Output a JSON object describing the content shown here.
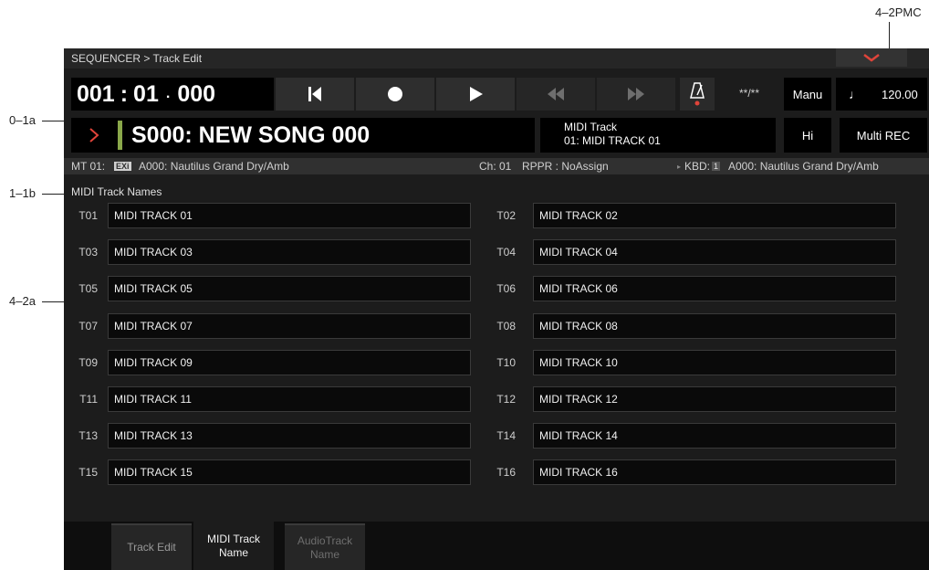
{
  "callouts": {
    "top_right": "4–2PMC",
    "left_1": "0–1a",
    "left_2": "1–1b",
    "left_3": "4–2a"
  },
  "titlebar": {
    "breadcrumb": "SEQUENCER > Track Edit"
  },
  "location": {
    "measure": "001",
    "sep1": ":",
    "beat": "01",
    "sep2": ".",
    "tick": "000"
  },
  "transport": {
    "meter": "**/**",
    "tempo_mode": "Manu",
    "tempo_icon": "♩",
    "tempo": "120.00"
  },
  "song": {
    "name": "S000: NEW SONG 000",
    "track_header": "MIDI Track",
    "track_name": "01: MIDI TRACK 01",
    "hi_label": "Hi",
    "rec_mode": "Multi REC"
  },
  "infobar": {
    "track": "MT 01:",
    "exi": "EXi",
    "program": "A000: Nautilus Grand Dry/Amb",
    "channel": "Ch: 01",
    "rppr": "RPPR : NoAssign",
    "kbd": "KBD:",
    "kbd_num": "1",
    "kbd_program": "A000: Nautilus Grand Dry/Amb"
  },
  "section": {
    "title": "MIDI Track Names"
  },
  "tracks": [
    {
      "id": "T01",
      "name": "MIDI TRACK 01"
    },
    {
      "id": "T02",
      "name": "MIDI TRACK 02"
    },
    {
      "id": "T03",
      "name": "MIDI TRACK 03"
    },
    {
      "id": "T04",
      "name": "MIDI TRACK 04"
    },
    {
      "id": "T05",
      "name": "MIDI TRACK 05"
    },
    {
      "id": "T06",
      "name": "MIDI TRACK 06"
    },
    {
      "id": "T07",
      "name": "MIDI TRACK 07"
    },
    {
      "id": "T08",
      "name": "MIDI TRACK 08"
    },
    {
      "id": "T09",
      "name": "MIDI TRACK 09"
    },
    {
      "id": "T10",
      "name": "MIDI TRACK 10"
    },
    {
      "id": "T11",
      "name": "MIDI TRACK 11"
    },
    {
      "id": "T12",
      "name": "MIDI TRACK 12"
    },
    {
      "id": "T13",
      "name": "MIDI TRACK 13"
    },
    {
      "id": "T14",
      "name": "MIDI TRACK 14"
    },
    {
      "id": "T15",
      "name": "MIDI TRACK 15"
    },
    {
      "id": "T16",
      "name": "MIDI TRACK 16"
    }
  ],
  "tabs": [
    {
      "line1": "Track Edit",
      "line2": ""
    },
    {
      "line1": "MIDI Track",
      "line2": "Name"
    },
    {
      "line1": "AudioTrack",
      "line2": "Name"
    }
  ],
  "colors": {
    "accent_red": "#e0443a",
    "song_bar_green": "#8aa84a",
    "screen_bg": "#1c1c1c"
  },
  "icons": [
    "chevron-down-icon",
    "skip-to-start-icon",
    "record-icon",
    "play-icon",
    "rewind-icon",
    "fast-forward-icon",
    "metronome-icon",
    "chevron-right-icon",
    "quarter-note-icon"
  ]
}
